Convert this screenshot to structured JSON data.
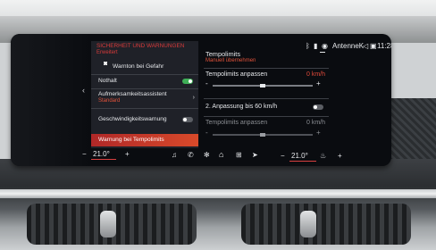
{
  "status_bar": {
    "radio": "AntenneK",
    "time": "11:28"
  },
  "settings_panel": {
    "header_line1": "SICHERHEIT UND WARNUNGEN",
    "header_line2": "Erweitert",
    "items": [
      {
        "label": "Warnton bei Gefahr"
      },
      {
        "label": "Nothalt",
        "toggle": "on"
      },
      {
        "label": "Aufmerksamkeitsassistent",
        "sub": "Standard"
      },
      {
        "label": "Geschwindigkeitswarnung",
        "toggle": "off"
      },
      {
        "label": "Warnung bei Tempolimits"
      }
    ]
  },
  "speed_panel": {
    "title": "Tempolimits",
    "subtitle": "Manuell übernehmen",
    "adjust1": {
      "label": "Tempolimits anpassen",
      "value": "0 km/h"
    },
    "adjust2": {
      "label": "2. Anpassung bis 60 km/h"
    },
    "adjust3": {
      "label": "Tempolimits anpassen",
      "value": "0 km/h"
    },
    "minus": "-",
    "plus": "+"
  },
  "bottom_bar": {
    "temp_left": "21.0°",
    "temp_right": "21.0°",
    "plus": "+",
    "minus": "−"
  },
  "icons": [
    "music-icon",
    "phone-icon",
    "fan-icon",
    "home-icon",
    "apps-icon",
    "navigation-icon",
    "seat-heat-icon",
    "wifi-icon",
    "bluetooth-icon"
  ],
  "colors": {
    "accent_red": "#d83a3a",
    "toggle_on": "#3fae57",
    "panel_bg": "#22242a"
  }
}
